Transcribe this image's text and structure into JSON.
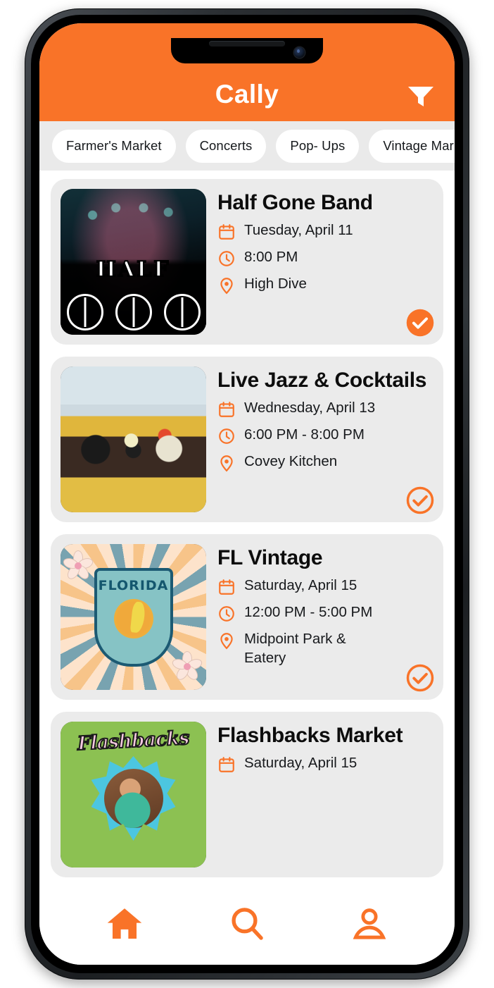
{
  "theme": {
    "accent": "#f97328",
    "chip_bg": "#ffffff",
    "chips_bar_bg": "#eaeaea",
    "card_bg": "#ebebeb"
  },
  "header": {
    "title": "Cally",
    "filter_icon": "filter-funnel-icon"
  },
  "chips": [
    {
      "label": "Farmer's Market"
    },
    {
      "label": "Concerts"
    },
    {
      "label": "Pop- Ups"
    },
    {
      "label": "Vintage Market"
    }
  ],
  "events": [
    {
      "title": "Half Gone Band",
      "date": "Tuesday, April 11",
      "time": "8:00 PM",
      "venue": "High Dive",
      "saved": true,
      "thumb": "concert-stage-photo"
    },
    {
      "title": "Live Jazz & Cocktails",
      "date": "Wednesday, April 13",
      "time": "6:00 PM - 8:00 PM",
      "venue": "Covey Kitchen",
      "saved": false,
      "thumb": "restaurant-table-photo"
    },
    {
      "title": "FL Vintage",
      "date": "Saturday, April 15",
      "time": "12:00 PM - 5:00 PM",
      "venue": "Midpoint Park & Eatery",
      "saved": false,
      "thumb": "florida-vintage-market-badge"
    },
    {
      "title": "Flashbacks Market",
      "date": "Saturday, April 15",
      "time": "",
      "venue": "",
      "saved": false,
      "thumb": "flashbacks-poster"
    }
  ],
  "icons": {
    "calendar": "calendar-icon",
    "clock": "clock-icon",
    "pin": "map-pin-icon",
    "check": "check-circle-icon"
  },
  "tabbar": [
    {
      "name": "home",
      "icon": "home-icon",
      "active": true
    },
    {
      "name": "search",
      "icon": "search-icon",
      "active": false
    },
    {
      "name": "profile",
      "icon": "person-icon",
      "active": false
    }
  ],
  "florida_badge": {
    "top_text": "FLORIDA"
  },
  "flashbacks_poster": {
    "title": "Flashbacks"
  },
  "concert_poster": {
    "text": "HALF"
  }
}
